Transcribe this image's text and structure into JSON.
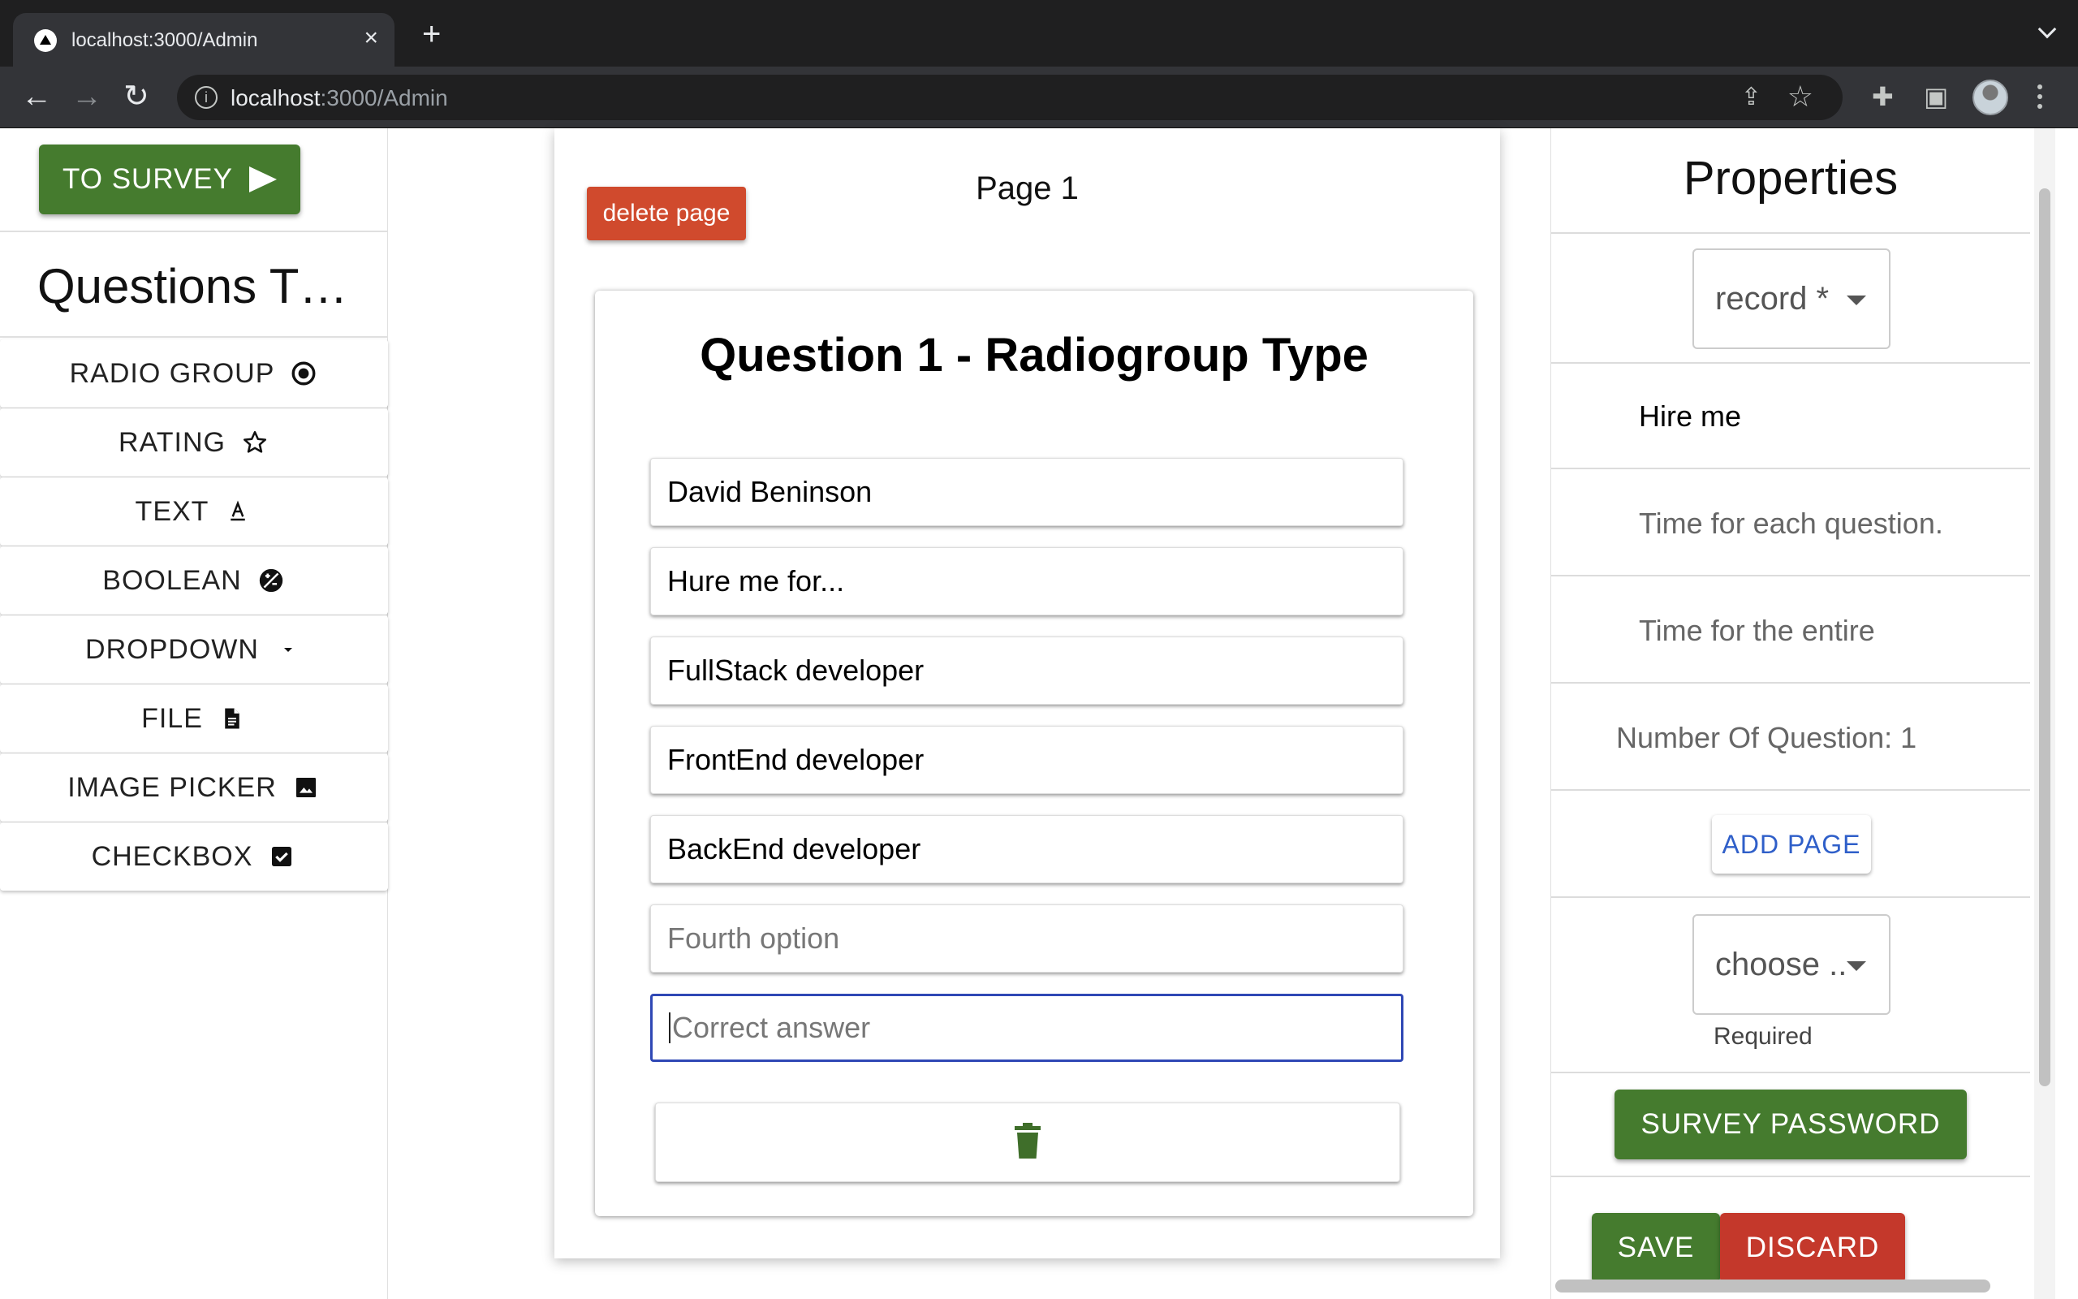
{
  "browser": {
    "tab_title": "localhost:3000/Admin",
    "url_host": "localhost",
    "url_path": ":3000/Admin"
  },
  "sidebar": {
    "to_survey_label": "TO SURVEY",
    "title": "Questions T…",
    "question_types": [
      {
        "label": "RADIO GROUP",
        "icon": "radio-button-icon"
      },
      {
        "label": "RATING",
        "icon": "star-outline-icon"
      },
      {
        "label": "TEXT",
        "icon": "text-format-icon"
      },
      {
        "label": "BOOLEAN",
        "icon": "boolean-icon"
      },
      {
        "label": "DROPDOWN",
        "icon": "dropdown-arrow-icon"
      },
      {
        "label": "FILE",
        "icon": "file-icon"
      },
      {
        "label": "IMAGE PICKER",
        "icon": "image-icon"
      },
      {
        "label": "CHECKBOX",
        "icon": "checkbox-icon"
      }
    ]
  },
  "editor": {
    "delete_page_label": "delete page",
    "page_title": "Page 1",
    "question_title": "Question 1 - Radiogroup Type",
    "options": [
      {
        "value": "David Beninson",
        "placeholder": ""
      },
      {
        "value": "Hure me for...",
        "placeholder": ""
      },
      {
        "value": "FullStack developer",
        "placeholder": ""
      },
      {
        "value": "FrontEnd developer",
        "placeholder": ""
      },
      {
        "value": "BackEnd developer",
        "placeholder": ""
      },
      {
        "value": "",
        "placeholder": "Fourth option"
      },
      {
        "value": "",
        "placeholder": "Correct answer"
      }
    ],
    "delete_icon": "trash-icon"
  },
  "properties": {
    "title": "Properties",
    "record_select": "record *",
    "survey_name": "Hire me",
    "time_each_placeholder": "Time for each question.",
    "time_entire_placeholder": "Time for the entire surve",
    "number_of_questions": "Number Of Question: 1",
    "add_page_label": "ADD PAGE",
    "choose_select": "choose ..",
    "required_label": "Required",
    "survey_password_label": "SURVEY PASSWORD",
    "save_label": "SAVE",
    "discard_label": "DISCARD"
  },
  "colors": {
    "primary_green": "#457b2e",
    "danger_red": "#c4382b",
    "delete_red": "#d04a2d",
    "focus_blue": "#2f48b5"
  }
}
